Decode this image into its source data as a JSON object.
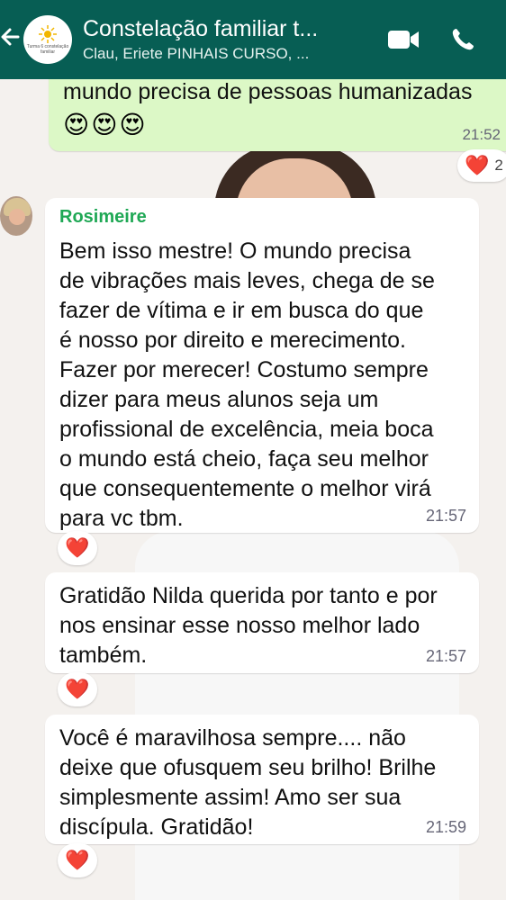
{
  "header": {
    "title": "Constelação familiar t...",
    "subtitle": "Clau, Eriete PINHAIS CURSO, ...",
    "avatar_text": "Turma 6 constelação familiar",
    "back_icon": "arrow-left-icon",
    "video_icon": "video-call-icon",
    "phone_icon": "phone-call-icon"
  },
  "messages": {
    "outgoing": {
      "text": "mundo precisa de pessoas humanizadas",
      "emoji": "😍😍😍",
      "time": "21:52",
      "reaction": "❤️",
      "reaction_count": "2"
    },
    "incoming": [
      {
        "sender": "Rosimeire",
        "text": "Bem isso mestre! O mundo precisa\nde vibrações mais leves, chega de se\nfazer de vítima e ir em busca do que\né nosso por direito e merecimento.\nFazer por merecer! Costumo sempre\ndizer para meus alunos seja um\nprofissional de excelência, meia boca\no mundo está cheio, faça seu melhor\nque consequentemente o melhor virá\npara vc tbm.",
        "time": "21:57",
        "reaction": "❤️"
      },
      {
        "text": "Gratidão Nilda querida por tanto e por\nnos ensinar esse nosso melhor lado\ntambém.",
        "time": "21:57",
        "reaction": "❤️"
      },
      {
        "text": "Você é maravilhosa sempre.... não\ndeixe que ofusquem seu brilho! Brilhe\nsimplesmente assim! Amo ser sua\ndiscípula. Gratidão!",
        "time": "21:59",
        "reaction": "❤️"
      }
    ]
  },
  "colors": {
    "header_bg": "#075e54",
    "outgoing_bg": "#dcf8c6",
    "incoming_bg": "#ffffff",
    "sender_name": "#1fa855",
    "reaction_heart": "#e0103a"
  }
}
